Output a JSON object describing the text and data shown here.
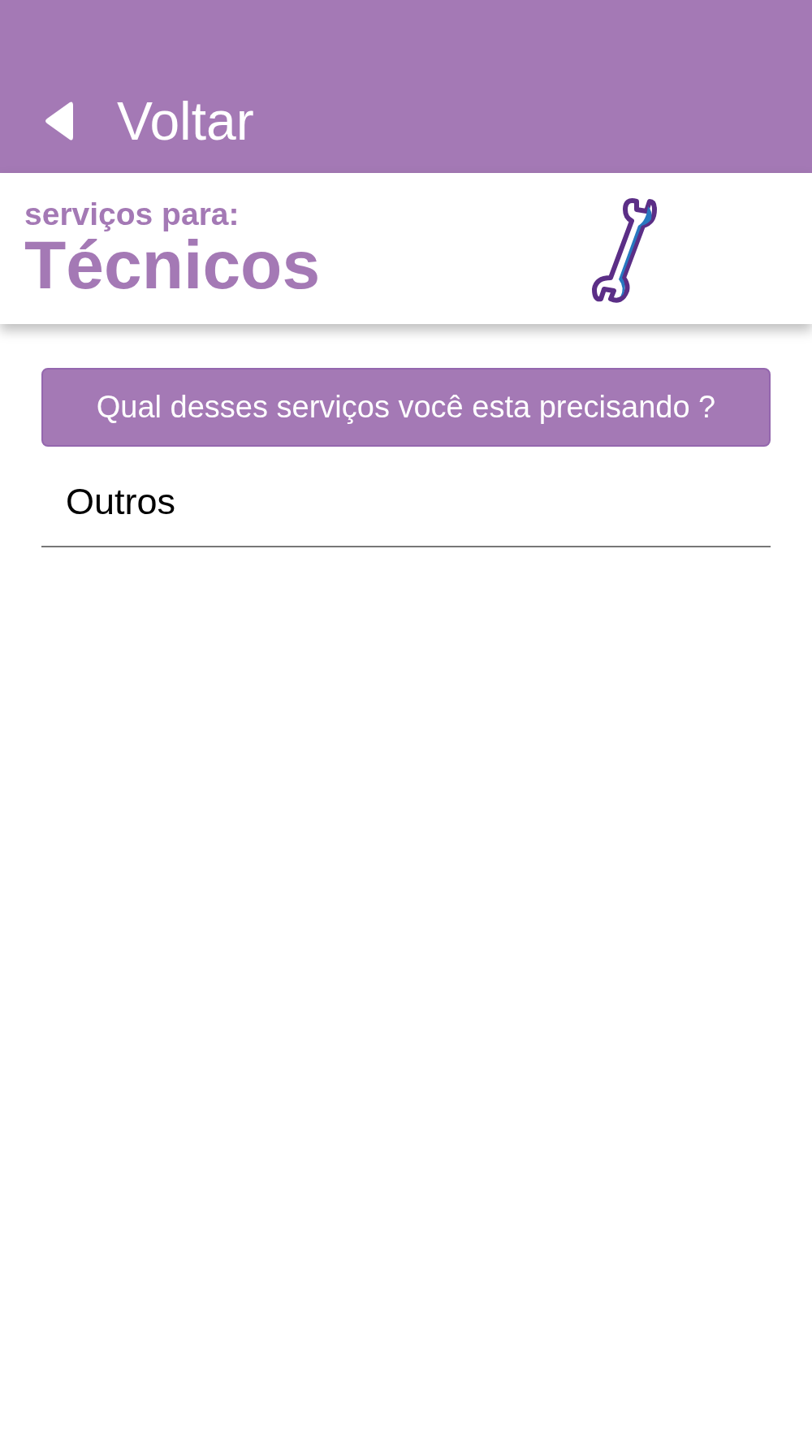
{
  "top_bar": {
    "back_label": "Voltar"
  },
  "header": {
    "subtitle": "serviços para:",
    "title": "Técnicos"
  },
  "prompt": "Qual desses serviços você esta precisando ?",
  "services": [
    {
      "label": "Outros"
    }
  ]
}
